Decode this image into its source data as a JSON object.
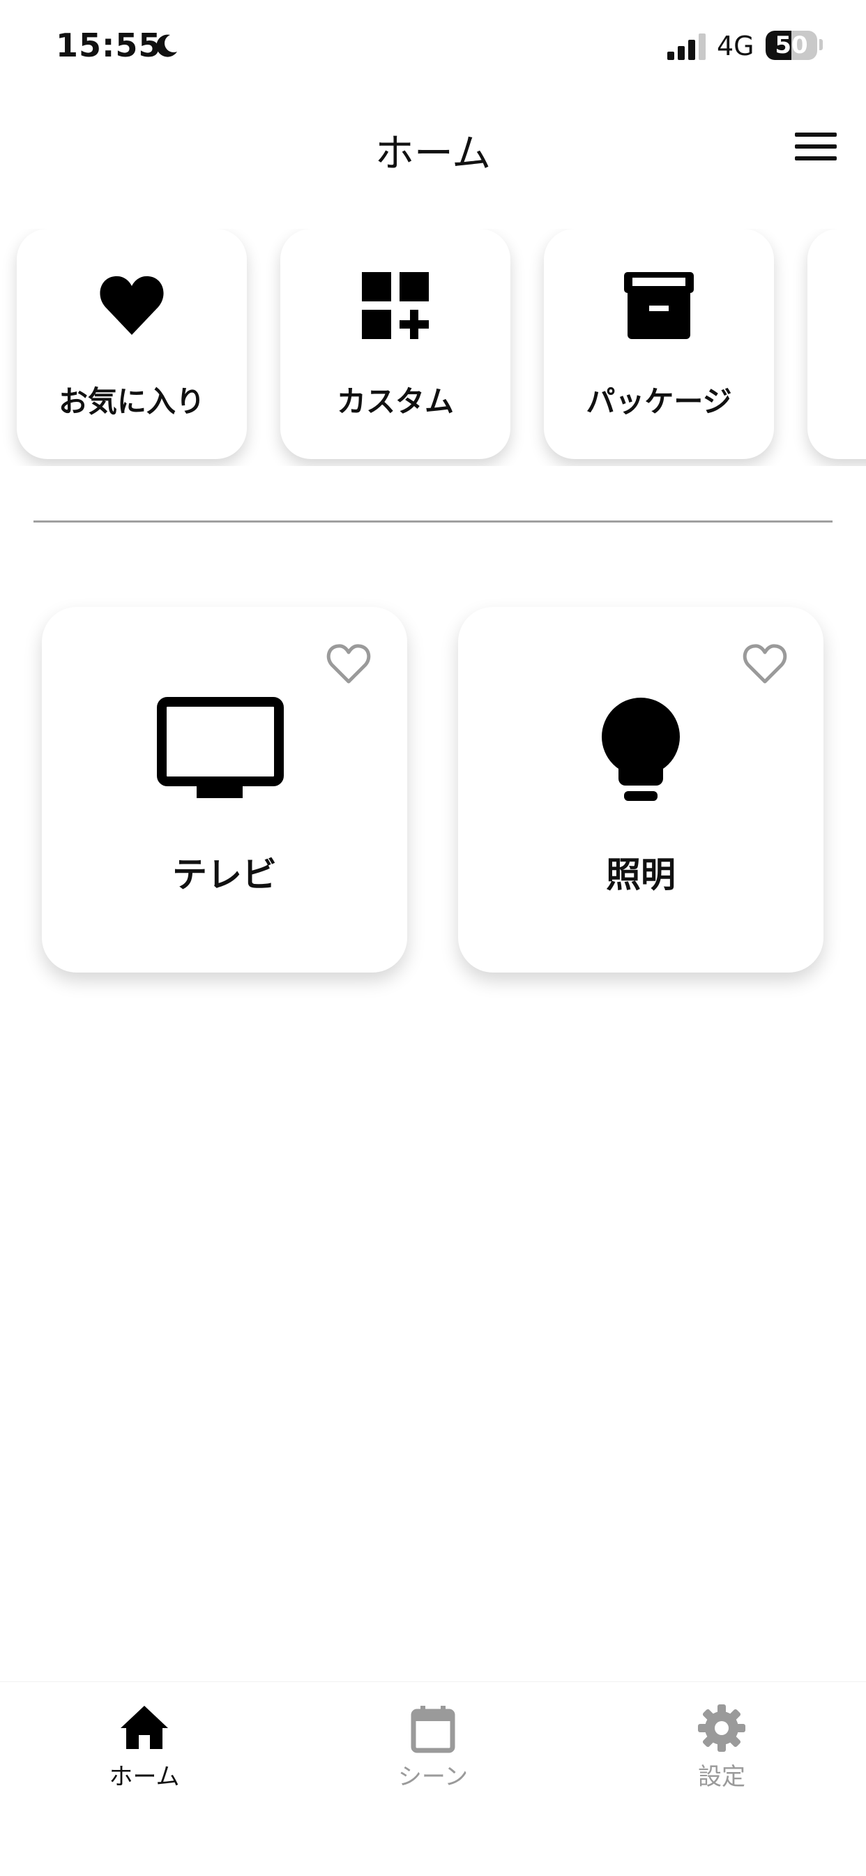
{
  "status_bar": {
    "time": "15:55",
    "network": "4G",
    "battery": "50",
    "battery_level_percent": 50,
    "signal_bars_active": 3
  },
  "header": {
    "title": "ホーム"
  },
  "categories": [
    {
      "label": "お気に入り",
      "icon": "heart-icon"
    },
    {
      "label": "カスタム",
      "icon": "grid-plus-icon"
    },
    {
      "label": "パッケージ",
      "icon": "archive-box-icon"
    },
    {
      "label": "",
      "icon": ""
    }
  ],
  "devices": [
    {
      "label": "テレビ",
      "icon": "tv-icon",
      "favorite": false
    },
    {
      "label": "照明",
      "icon": "lightbulb-icon",
      "favorite": false
    }
  ],
  "bottom_nav": [
    {
      "label": "ホーム",
      "icon": "home-icon",
      "active": true
    },
    {
      "label": "シーン",
      "icon": "calendar-icon",
      "active": false
    },
    {
      "label": "設定",
      "icon": "gear-icon",
      "active": false
    }
  ],
  "colors": {
    "accent": "#111111",
    "inactive": "#9a9a9a",
    "divider": "#a0a0a0",
    "background": "#ffffff"
  }
}
